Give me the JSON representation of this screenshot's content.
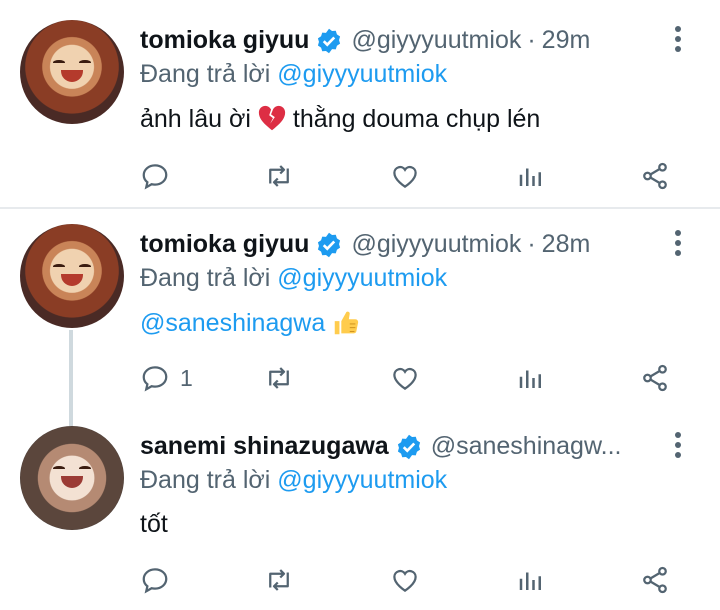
{
  "tweets": [
    {
      "name": "tomioka giyuu",
      "handle": "@giyyyuutmiok",
      "separator": "·",
      "time": "29m",
      "reply_prefix": "Đang trả lời",
      "reply_to": "@giyyyuutmiok",
      "text": "ảnh lâu ời",
      "emoji": "broken-heart-icon",
      "text_after": "thằng douma chụp lén",
      "reply_count": ""
    },
    {
      "name": "tomioka giyuu",
      "handle": "@giyyyuutmiok",
      "separator": "·",
      "time": "28m",
      "reply_prefix": "Đang trả lời",
      "reply_to": "@giyyyuutmiok",
      "mention": "@saneshinagwa",
      "emoji": "thumbs-up-icon",
      "reply_count": "1"
    },
    {
      "name": "sanemi shinazugawa",
      "handle": "@saneshinagw...",
      "reply_prefix": "Đang trả lời",
      "reply_to": "@giyyyuutmiok",
      "text": "tốt",
      "reply_count": ""
    }
  ],
  "colors": {
    "accent": "#1d9bf0",
    "muted": "#536471",
    "text": "#0f1419",
    "divider": "#e7eaed"
  }
}
